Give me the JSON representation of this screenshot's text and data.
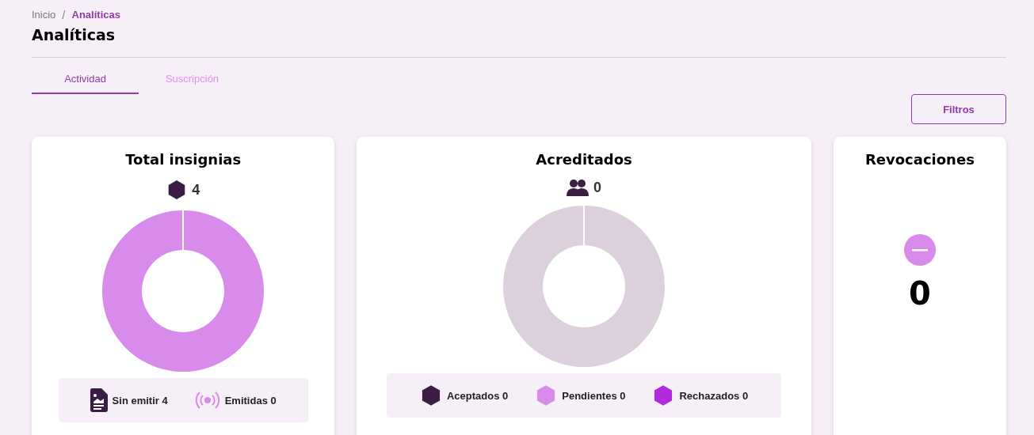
{
  "breadcrumb": [
    {
      "label": "Inicio",
      "selected": false
    },
    {
      "label": "Analíticas",
      "selected": true
    }
  ],
  "breadcrumb_separator": "/",
  "title": "Analíticas",
  "tabs": [
    {
      "label": "Actividad",
      "selected": true
    },
    {
      "label": "Suscripción",
      "selected": false
    }
  ],
  "filter_button": "Filtros",
  "cards": [
    {
      "kind": "hexagon-donut",
      "title": "Total insignias",
      "count": "4",
      "empty": false,
      "legend": [
        {
          "kind": "document",
          "label": "Sin emitir 4",
          "color": "#3b1c42"
        },
        {
          "kind": "broadcast",
          "label": "Emitidas 0",
          "color": "#d98bec"
        }
      ]
    },
    {
      "kind": "people-donut",
      "title": "Acreditados",
      "count": "0",
      "empty": true,
      "legend": [
        {
          "kind": "hexagon",
          "label": "Aceptados 0",
          "color": "#3b1c42"
        },
        {
          "kind": "hexagon",
          "label": "Pendientes 0",
          "color": "#d98bec"
        },
        {
          "kind": "hexagon",
          "label": "Rechazados 0",
          "color": "#b02ae0"
        }
      ]
    },
    {
      "kind": "stat",
      "title": "Revocaciones",
      "count": "0"
    }
  ]
}
